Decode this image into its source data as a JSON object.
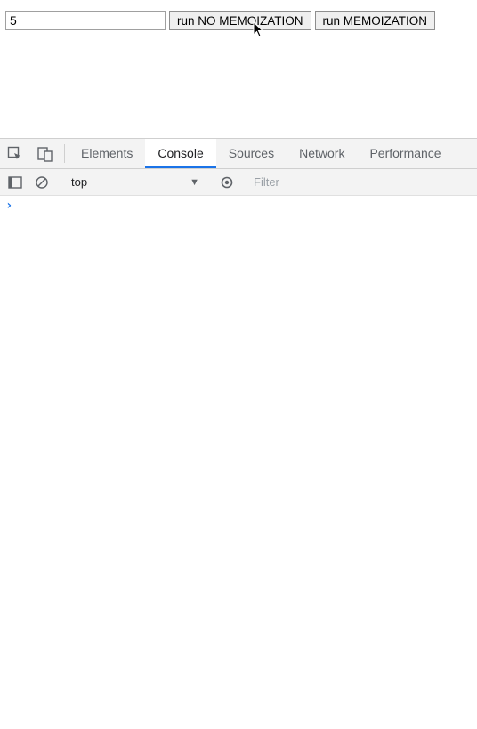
{
  "page": {
    "input_value": "5",
    "btn_no_memo": "run NO MEMOIZATION",
    "btn_memo": "run MEMOIZATION"
  },
  "devtools": {
    "tabs": {
      "elements": "Elements",
      "console": "Console",
      "sources": "Sources",
      "network": "Network",
      "performance": "Performance"
    },
    "active_tab": "console",
    "context": {
      "selected": "top"
    },
    "filter_placeholder": "Filter",
    "prompt": "›"
  },
  "colors": {
    "accent": "#1a73e8",
    "icon": "#5f6368"
  }
}
